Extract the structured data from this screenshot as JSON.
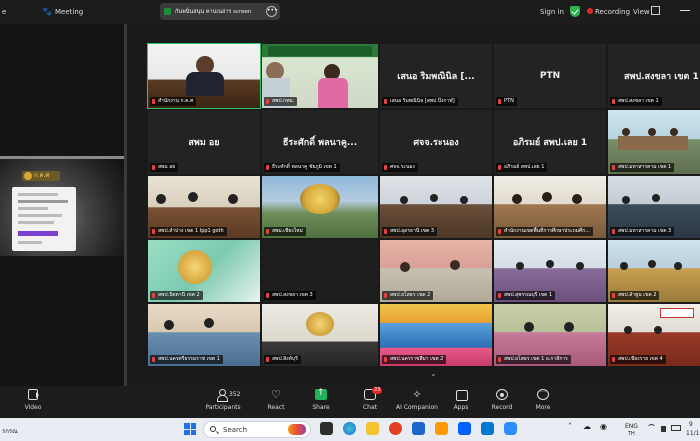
{
  "topbar": {
    "left_cut": "e",
    "meeting_label": "Meeting",
    "share_text": "กันพนิ่นสนุน คานเนอ่าร screen",
    "sign_in": "Sign in",
    "recording": "Recording",
    "view": "View"
  },
  "shared_screen": {
    "logo_text": "ก.ค.ศ"
  },
  "gallery": {
    "tiles": [
      {
        "label": "สำนักงาน ก.ค.ศ"
      },
      {
        "label": "สพป.กทม."
      },
      {
        "title": "เสนอ  ริมพณินิล [...",
        "label": "เสนอ  ริมพณินิล [สพป.บึงกาฬ]"
      },
      {
        "title": "PTN",
        "label": "PTN"
      },
      {
        "title": "สพป.สงขลา เขต 1",
        "label": "สพป.สงขลา เขต 1"
      },
      {
        "title": "สพม อย",
        "label": "สพม อย"
      },
      {
        "title": "ธีระศักดิ์ พลนาคู...",
        "label": "ธีระศักดิ์ พลนาคู ชัยภูมิ เขต 1"
      },
      {
        "title": "ศจจ.ระนอง",
        "label": "ศจจ.ระนอง"
      },
      {
        "title": "อภิรมย์ สพป.เลย 1",
        "label": "อภิรมย์ สพป.เลย 1"
      },
      {
        "label": "สพป.มหาสารคาม เขต 1"
      },
      {
        "label": "สพป.ลำปาง เขต 1 Ipp1 goth"
      },
      {
        "label": "สพม.เชียงใหม่"
      },
      {
        "label": "สพป.อุดรธานี เขต 3"
      },
      {
        "label": "สำนักงานเขตพื้นที่การศึกษาประถมศึก..."
      },
      {
        "label": "สพป.มหาสารคาม เขต 3"
      },
      {
        "label": "สพป.ปัตตานี เขต 2"
      },
      {
        "label": "สพป.สงขลา เขต 3"
      },
      {
        "label": "สพป.ยโสธร เขต 2"
      },
      {
        "label": "สพป.สุพรรณบุรี เขต 1"
      },
      {
        "label": "สพป.ลำพูน เขต 2"
      },
      {
        "label": "สพป.นครศรีธรรมราช เขต 1"
      },
      {
        "label": "สพป.สิงห์บุรี"
      },
      {
        "label": "สพป.นครราชสีมา เขต 2"
      },
      {
        "label": "สพป.ยโสธร เขต 1 อ.กาสิการ"
      },
      {
        "label": "สพป.เชียงราย เขต 4"
      }
    ]
  },
  "toolbar": {
    "video": "Video",
    "participants": "Participants",
    "participants_count": "352",
    "react": "React",
    "share": "Share",
    "chat": "Chat",
    "chat_badge": "23",
    "ai_companion": "AI Companion",
    "apps": "Apps",
    "record": "Record",
    "more": "More"
  },
  "taskbar": {
    "left_text": "รกรณ",
    "search": "Search",
    "lang": "ENG",
    "lang2": "TH",
    "clock_top": "9",
    "clock_bottom": "11/1"
  }
}
